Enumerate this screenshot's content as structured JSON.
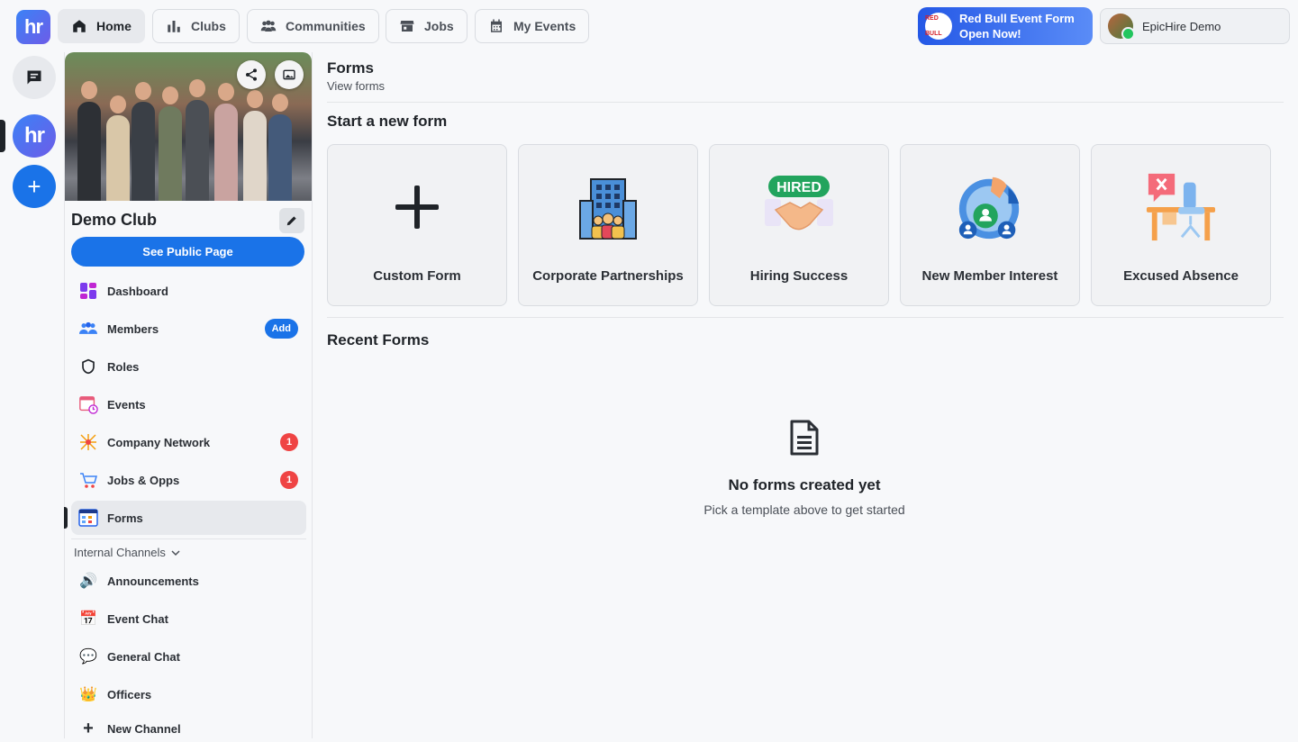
{
  "nav": {
    "logo_text": "hr",
    "tabs": [
      {
        "label": "Home",
        "icon": "home-icon"
      },
      {
        "label": "Clubs",
        "icon": "bar-chart-icon"
      },
      {
        "label": "Communities",
        "icon": "people-icon"
      },
      {
        "label": "Jobs",
        "icon": "store-icon"
      },
      {
        "label": "My Events",
        "icon": "calendar-icon"
      }
    ],
    "promo": {
      "line1": "Red Bull Event Form",
      "line2": "Open Now!",
      "badge_text": "RED BULL"
    },
    "user": {
      "name": "EpicHire Demo"
    }
  },
  "rail": {
    "club_text": "hr"
  },
  "sidebar": {
    "club_name": "Demo Club",
    "public_button": "See Public Page",
    "items": [
      {
        "label": "Dashboard",
        "icon": "dashboard-icon"
      },
      {
        "label": "Members",
        "icon": "members-icon",
        "action": "Add"
      },
      {
        "label": "Roles",
        "icon": "shield-icon"
      },
      {
        "label": "Events",
        "icon": "calendar-clock-icon"
      },
      {
        "label": "Company Network",
        "icon": "network-icon",
        "count": "1"
      },
      {
        "label": "Jobs & Opps",
        "icon": "cart-icon",
        "count": "1"
      },
      {
        "label": "Forms",
        "icon": "forms-icon",
        "active": true
      }
    ],
    "channels_header": "Internal Channels",
    "channels": [
      {
        "label": "Announcements",
        "icon": "speaker-icon",
        "glyph": "🔊"
      },
      {
        "label": "Event Chat",
        "icon": "calendar-icon",
        "glyph": "📅"
      },
      {
        "label": "General Chat",
        "icon": "speech-bubble-icon",
        "glyph": "💬"
      },
      {
        "label": "Officers",
        "icon": "crown-icon",
        "glyph": "👑"
      },
      {
        "label": "New Channel",
        "icon": "plus-icon",
        "glyph": "+"
      }
    ]
  },
  "main": {
    "title": "Forms",
    "subtitle": "View forms",
    "start_heading": "Start a new form",
    "templates": [
      {
        "label": "Custom Form",
        "icon": "plus-icon"
      },
      {
        "label": "Corporate Partnerships",
        "icon": "office-building-icon"
      },
      {
        "label": "Hiring Success",
        "icon": "hired-handshake-icon",
        "icon_text": "HIRED"
      },
      {
        "label": "New Member Interest",
        "icon": "member-interest-icon"
      },
      {
        "label": "Excused Absence",
        "icon": "absence-desk-icon"
      }
    ],
    "recent_heading": "Recent Forms",
    "empty_title": "No forms created yet",
    "empty_subtitle": "Pick a template above to get started"
  },
  "colors": {
    "primary": "#1a73e8",
    "badge": "#ef4444",
    "background": "#f7f8fa"
  }
}
